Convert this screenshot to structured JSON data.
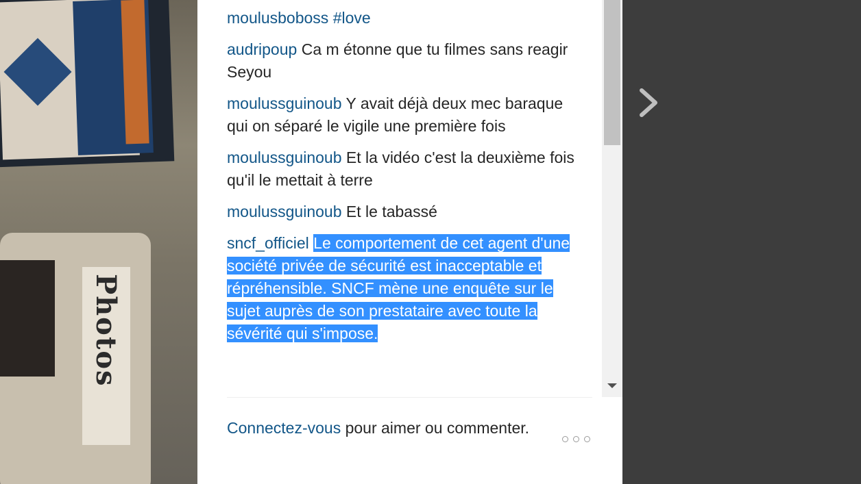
{
  "photo": {
    "label_text": "Photos"
  },
  "comments": [
    {
      "user": "moulusboboss",
      "text": "#love"
    },
    {
      "user": "audripoup",
      "text": "Ca m étonne que tu filmes sans reagir Seyou"
    },
    {
      "user": "moulussguinoub",
      "text": "Y avait déjà deux mec baraque qui on séparé le vigile une première fois"
    },
    {
      "user": "moulussguinoub",
      "text": "Et la vidéo c'est la deuxième fois qu'il le mettait à terre"
    },
    {
      "user": "moulussguinoub",
      "text": "Et le tabassé"
    },
    {
      "user": "sncf_officiel",
      "text": "Le comportement de cet agent d'une société privée de sécurité est inacceptable et répréhensible. SNCF mène une enquête sur le sujet auprès de son prestataire avec toute la sévérité qui s'impose."
    }
  ],
  "footer": {
    "login_link": "Connectez-vous",
    "login_rest": " pour aimer ou commenter."
  },
  "icons": {
    "more": "more-options-icon",
    "next": "chevron-right-icon",
    "scroll_down": "scroll-down-arrow-icon"
  },
  "colors": {
    "username": "#125688",
    "selection": "#3390ff",
    "backdrop": "#3d3d3d"
  }
}
